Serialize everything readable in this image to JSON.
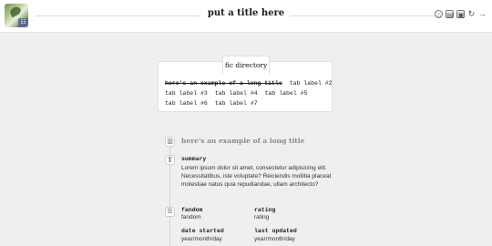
{
  "header": {
    "site_title": "put a title here",
    "avatar_badge": "☷",
    "icons": [
      {
        "name": "home-icon",
        "glyph": "⌂"
      },
      {
        "name": "archive-icon",
        "glyph": "▤"
      },
      {
        "name": "inbox-icon",
        "glyph": "▣"
      },
      {
        "name": "refresh-icon",
        "glyph": "↻"
      },
      {
        "name": "log-out-icon",
        "glyph": "→"
      }
    ]
  },
  "directory": {
    "heading": "fic directory",
    "tabs": [
      [
        "here's an example of a long title",
        "tab label #2"
      ],
      [
        "tab label #3",
        "tab label #4",
        "tab label #5"
      ],
      [
        "tab label #6",
        "tab label #7"
      ]
    ]
  },
  "entry": {
    "title": "here's an example of a long title",
    "summary_label": "summary",
    "summary_text": "Lorem ipsum dolor sit amet, consectetur adipisicing elit. Necessitatibus, iste voluptate? Reiciendis mollitia placeat molestiae natus quia repudiandae, ullam architecto?",
    "fandom_label": "fandom",
    "fandom_value": "fandom",
    "rating_label": "rating",
    "rating_value": "rating",
    "date_started_label": "date started",
    "date_started_value": "year/month/day",
    "last_updated_label": "last updated",
    "last_updated_value": "year/month/day"
  }
}
